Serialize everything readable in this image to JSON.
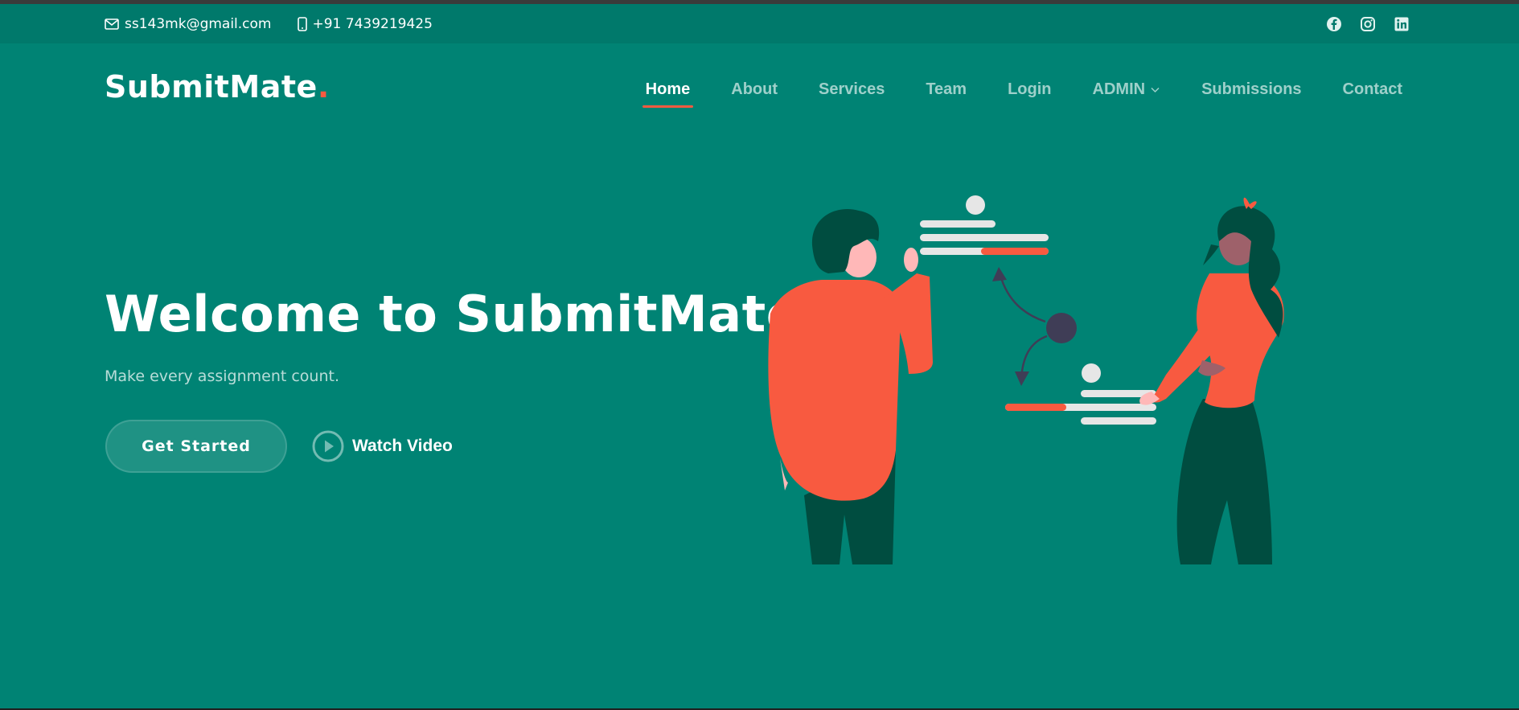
{
  "topbar": {
    "email": "ss143mk@gmail.com",
    "phone": "+91 7439219425",
    "social": [
      "facebook-icon",
      "instagram-icon",
      "linkedin-icon"
    ]
  },
  "brand": {
    "name": "SubmitMate",
    "dot": "."
  },
  "nav": {
    "items": [
      {
        "label": "Home",
        "active": true
      },
      {
        "label": "About"
      },
      {
        "label": "Services"
      },
      {
        "label": "Team"
      },
      {
        "label": "Login"
      },
      {
        "label": "ADMIN",
        "dropdown": true
      },
      {
        "label": "Submissions"
      },
      {
        "label": "Contact"
      }
    ]
  },
  "hero": {
    "title": "Welcome to SubmitMate",
    "subtitle": "Make every assignment count.",
    "cta_label": "Get Started",
    "video_label": "Watch Video"
  },
  "colors": {
    "background": "#008374",
    "topbar": "#00796b",
    "accent": "#f85a40",
    "dark_green": "#004d40"
  }
}
